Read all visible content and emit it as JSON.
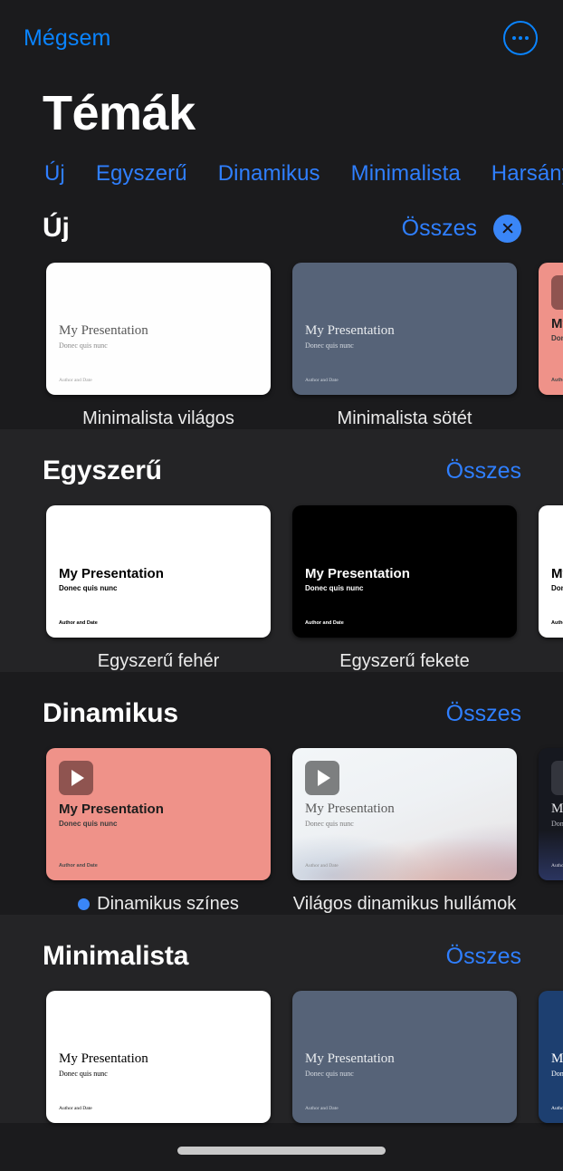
{
  "topbar": {
    "cancel_label": "Mégsem",
    "more_icon": "ellipsis-circle-icon"
  },
  "page_title": "Témák",
  "accent_color": "#2f7fff",
  "tabs": [
    {
      "label": "Új"
    },
    {
      "label": "Egyszerű"
    },
    {
      "label": "Dinamikus"
    },
    {
      "label": "Minimalista"
    },
    {
      "label": "Harsány"
    }
  ],
  "slide_text": {
    "title": "My Presentation",
    "subtitle": "Donec quis nunc",
    "footer": "Author and Date"
  },
  "sections": [
    {
      "title": "Új",
      "see_all": "Összes",
      "has_cursor": true,
      "cards": [
        {
          "caption": "Minimalista világos",
          "theme": "t-minlight",
          "font": "serif",
          "play": false,
          "selected": false
        },
        {
          "caption": "Minimalista sötét",
          "theme": "t-mindark",
          "font": "serif",
          "play": false,
          "selected": false
        },
        {
          "caption": "",
          "theme": "t-salmon",
          "font": "sans-b",
          "play": true,
          "selected": false
        }
      ]
    },
    {
      "title": "Egyszerű",
      "see_all": "Összes",
      "has_cursor": false,
      "cards": [
        {
          "caption": "Egyszerű fehér",
          "theme": "t-white",
          "font": "sans-b",
          "play": false,
          "selected": false
        },
        {
          "caption": "Egyszerű fekete",
          "theme": "t-black",
          "font": "sans-b",
          "play": false,
          "selected": false
        },
        {
          "caption": "",
          "theme": "t-white",
          "font": "sans-b",
          "play": false,
          "selected": false
        }
      ]
    },
    {
      "title": "Dinamikus",
      "see_all": "Összes",
      "has_cursor": false,
      "cards": [
        {
          "caption": "Dinamikus színes",
          "theme": "t-salmon",
          "font": "sans-b",
          "play": true,
          "selected": true
        },
        {
          "caption": "Világos dinamikus hullámok",
          "theme": "t-waves",
          "font": "serif",
          "play": true,
          "selected": false
        },
        {
          "caption": "",
          "theme": "t-navydark",
          "font": "serif",
          "play": true,
          "selected": false
        }
      ]
    },
    {
      "title": "Minimalista",
      "see_all": "Összes",
      "has_cursor": false,
      "cards": [
        {
          "caption": "",
          "theme": "t-white",
          "font": "serif",
          "play": false,
          "selected": false
        },
        {
          "caption": "",
          "theme": "t-mindark",
          "font": "serif",
          "play": false,
          "selected": false
        },
        {
          "caption": "",
          "theme": "t-navy",
          "font": "serif",
          "play": false,
          "selected": false
        }
      ]
    }
  ]
}
